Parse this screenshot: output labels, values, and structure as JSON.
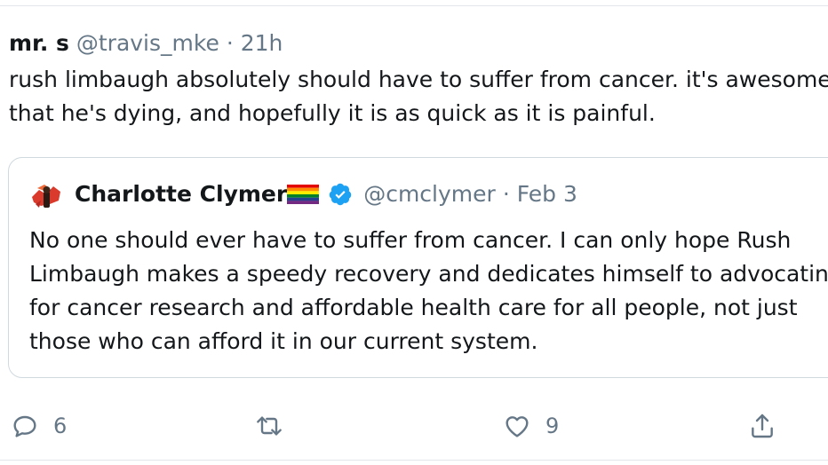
{
  "tweet": {
    "display_name": "mr. s",
    "handle": "@travis_mke",
    "separator": "·",
    "time": "21h",
    "text": "rush limbaugh absolutely should have to suffer from cancer. it's awesome\nthat he's dying, and hopefully it is as quick as it is painful."
  },
  "quoted_tweet": {
    "display_name": "Charlotte Clymer",
    "verified": true,
    "handle": "@cmclymer",
    "separator": "·",
    "date": "Feb 3",
    "text": "No one should ever have to suffer from cancer. I can only hope Rush\nLimbaugh makes a speedy recovery and dedicates himself to advocating\nfor cancer research and affordable health care for all people, not just\nthose who can afford it in our current system."
  },
  "actions": {
    "reply_count": "6",
    "retweet_count": "",
    "like_count": "9"
  },
  "colors": {
    "text": "#14171a",
    "secondary": "#657786",
    "verified": "#1da1f2",
    "border": "#cfd9de"
  },
  "icons": [
    "reply-icon",
    "retweet-icon",
    "like-icon",
    "share-icon",
    "verified-badge-icon",
    "rainbow-flag-icon"
  ]
}
